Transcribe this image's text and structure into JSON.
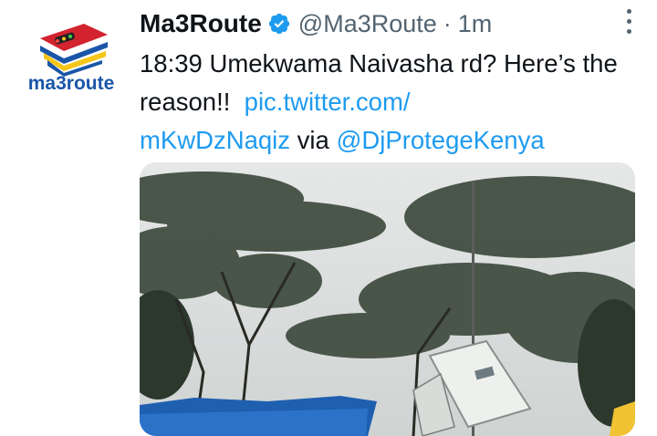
{
  "tweet": {
    "display_name": "Ma3Route",
    "handle": "@Ma3Route",
    "separator": "·",
    "time": "1m",
    "text_main": "18:39 Umekwama Naivasha rd? Here’s the reason!!",
    "link_part1": "pic.twitter.com/",
    "link_part2": "mKwDzNaqiz",
    "via_text": "via",
    "mention": "@DjProtegeKenya"
  },
  "avatar": {
    "logo_text": "ma3route"
  },
  "icons": {
    "verified": "verified-badge-icon",
    "more": "more-options-icon"
  },
  "colors": {
    "link": "#1d9bf0",
    "secondary": "#536471",
    "text": "#0f1419",
    "logo_red": "#d3232f",
    "logo_blue": "#1a56a8",
    "logo_yellow": "#f5c518"
  }
}
